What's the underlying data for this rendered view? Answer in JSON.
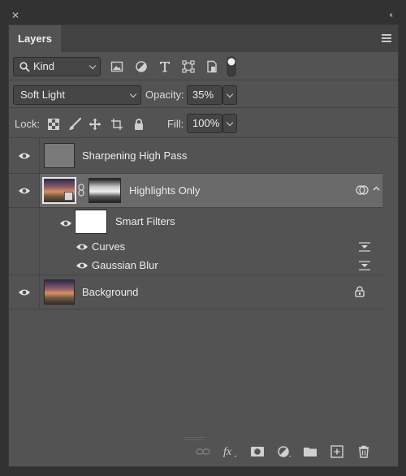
{
  "window": {
    "close_glyph": "✕",
    "collapse_glyph": "‹‹"
  },
  "tab": {
    "label": "Layers"
  },
  "filter": {
    "kind_label": "Kind",
    "icons": [
      "pixel-filter-icon",
      "adjustment-filter-icon",
      "type-filter-icon",
      "shape-filter-icon",
      "smart-object-filter-icon",
      "filter-toggle-icon"
    ]
  },
  "blend": {
    "mode": "Soft Light",
    "opacity_label": "Opacity:",
    "opacity_value": "35%"
  },
  "lock": {
    "label": "Lock:",
    "fill_label": "Fill:",
    "fill_value": "100%"
  },
  "layers": {
    "sharpening": {
      "name": "Sharpening High Pass"
    },
    "highlights": {
      "name": "Highlights Only"
    },
    "smart_filters": {
      "name": "Smart Filters"
    },
    "curves": {
      "name": "Curves"
    },
    "gaussian": {
      "name": "Gaussian Blur"
    },
    "background": {
      "name": "Background"
    }
  },
  "colors": {
    "panel_bg": "#535353",
    "selected_bg": "#6a6a6a",
    "text": "#ececec"
  }
}
